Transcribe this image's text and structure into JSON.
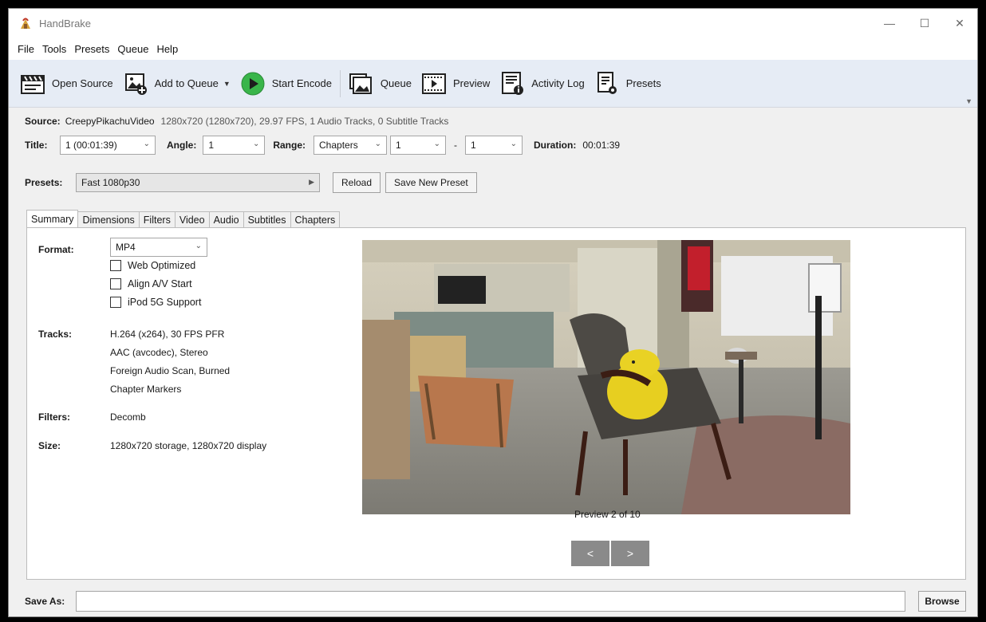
{
  "window": {
    "title": "HandBrake"
  },
  "menu": [
    "File",
    "Tools",
    "Presets",
    "Queue",
    "Help"
  ],
  "toolbar": {
    "open_source": "Open Source",
    "add_to_queue": "Add to Queue",
    "start_encode": "Start Encode",
    "queue": "Queue",
    "preview": "Preview",
    "activity_log": "Activity Log",
    "presets": "Presets"
  },
  "source": {
    "label": "Source:",
    "name": "CreepyPikachuVideo",
    "details": "1280x720 (1280x720), 29.97 FPS, 1 Audio Tracks, 0 Subtitle Tracks"
  },
  "title_row": {
    "title_label": "Title:",
    "title_value": "1 (00:01:39)",
    "angle_label": "Angle:",
    "angle_value": "1",
    "range_label": "Range:",
    "range_value": "Chapters",
    "range_start": "1",
    "range_dash": "-",
    "range_end": "1",
    "duration_label": "Duration:",
    "duration_value": "00:01:39"
  },
  "presets_row": {
    "label": "Presets:",
    "value": "Fast 1080p30",
    "reload": "Reload",
    "save_new": "Save New Preset"
  },
  "tabs": [
    "Summary",
    "Dimensions",
    "Filters",
    "Video",
    "Audio",
    "Subtitles",
    "Chapters"
  ],
  "summary": {
    "format_label": "Format:",
    "format_value": "MP4",
    "options": [
      {
        "label": "Web Optimized",
        "checked": false
      },
      {
        "label": "Align A/V Start",
        "checked": false
      },
      {
        "label": "iPod 5G Support",
        "checked": false
      }
    ],
    "tracks_label": "Tracks:",
    "tracks": [
      "H.264 (x264), 30 FPS PFR",
      "AAC (avcodec), Stereo",
      "Foreign Audio Scan, Burned",
      "Chapter Markers"
    ],
    "filters_label": "Filters:",
    "filters_value": "Decomb",
    "size_label": "Size:",
    "size_value": "1280x720 storage, 1280x720 display"
  },
  "preview": {
    "caption": "Preview 2 of 10",
    "prev": "<",
    "next": ">"
  },
  "save": {
    "label": "Save As:",
    "value": "",
    "browse": "Browse"
  },
  "colors": {
    "play_green": "#39b54a",
    "toolbar_bg": "#e6ecf5",
    "nav_button": "#8a8a8a"
  }
}
